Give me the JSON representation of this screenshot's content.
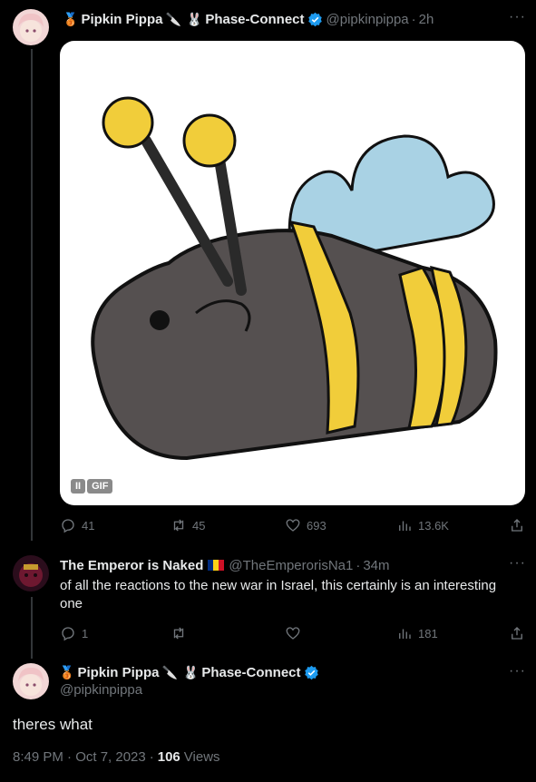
{
  "colors": {
    "background": "#000000",
    "text": "#e7e9ea",
    "muted": "#71767b",
    "verified": "#1d9bf0",
    "thread_line": "#333639"
  },
  "tweet1": {
    "display_name": "Pipkin Pippa",
    "affiliation": "Phase-Connect",
    "handle": "@pipkinpippa",
    "time": "2h",
    "media_type": "GIF",
    "media_pause_label": "II",
    "actions": {
      "replies": "41",
      "retweets": "45",
      "likes": "693",
      "views": "13.6K"
    }
  },
  "tweet2": {
    "display_name": "The Emperor is Naked",
    "handle": "@TheEmperorisNa1",
    "time": "34m",
    "text": "of all the reactions to the new war in Israel, this certainly is an interesting one",
    "actions": {
      "replies": "1",
      "retweets": "",
      "likes": "",
      "views": "181"
    }
  },
  "main_tweet": {
    "display_name": "Pipkin Pippa",
    "affiliation": "Phase-Connect",
    "handle": "@pipkinpippa",
    "text": "theres what",
    "timestamp": "8:49 PM · Oct 7, 2023",
    "views_count": "106",
    "views_label": "Views"
  },
  "icons": {
    "medal": "medal-icon",
    "knife": "knife-icon",
    "rabbit": "rabbit-icon",
    "verified": "verified-badge-icon",
    "flag": "romania-flag-icon",
    "reply": "reply-icon",
    "retweet": "retweet-icon",
    "like": "heart-icon",
    "views": "views-icon",
    "share": "share-icon",
    "more": "more-icon"
  }
}
